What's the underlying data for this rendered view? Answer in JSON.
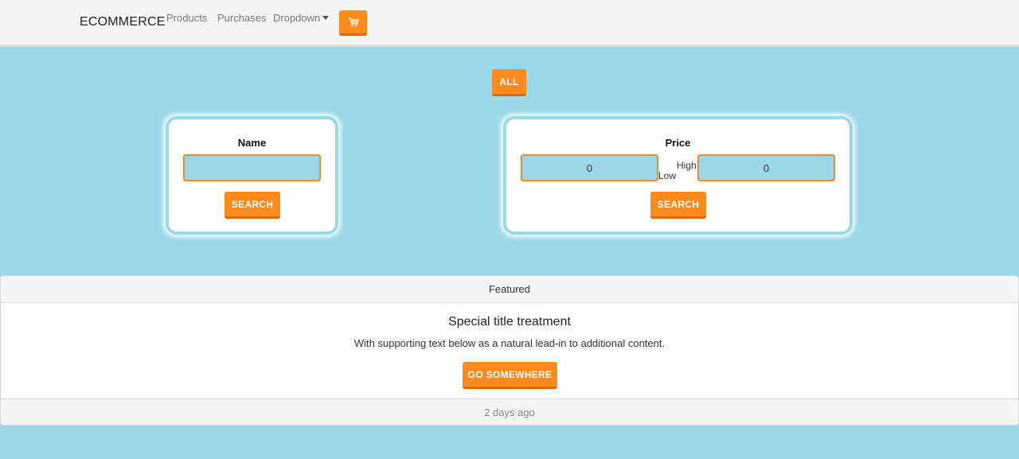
{
  "navbar": {
    "brand": "ECOMMERCE",
    "links": [
      "Products",
      "Purchases"
    ],
    "dropdown_label": "Dropdown",
    "cart_icon": "cart-icon"
  },
  "filters": {
    "all_label": "ALL",
    "name_panel": {
      "title": "Name",
      "input_value": "",
      "search_label": "SEARCH"
    },
    "price_panel": {
      "title": "Price",
      "low_value": "0",
      "low_label": "Low",
      "high_label": "High",
      "high_value": "0",
      "search_label": "SEARCH"
    }
  },
  "card": {
    "header": "Featured",
    "title": "Special title treatment",
    "text": "With supporting text below as a natural lead-in to additional content.",
    "button_label": "GO SOMEWHERE",
    "footer": "2 days ago"
  },
  "colors": {
    "accent": "#ff8a1e",
    "background": "#9bd8e8"
  }
}
